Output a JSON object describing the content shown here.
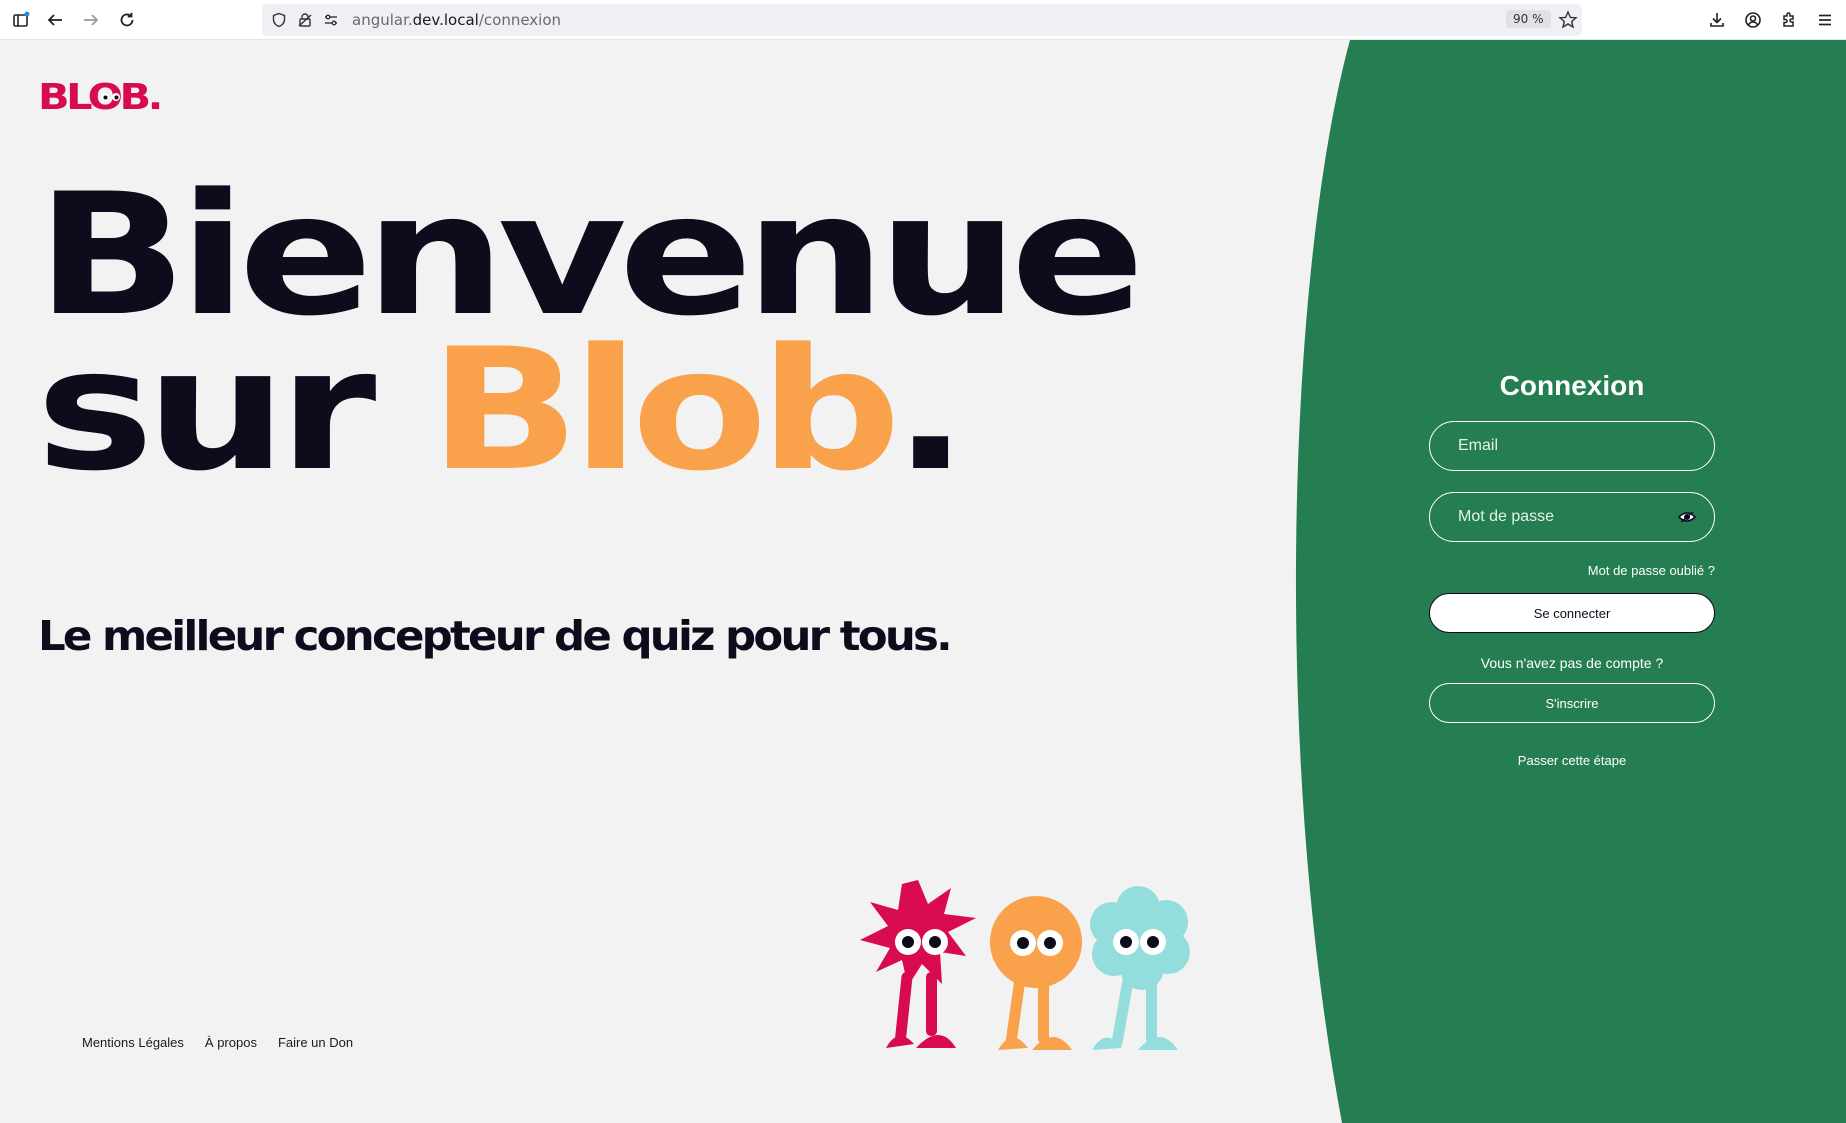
{
  "browser": {
    "url_prefix": "angular.",
    "url_host": "dev.local",
    "url_path": "/connexion",
    "zoom": "90 %"
  },
  "brand": {
    "logo_text": "BLOB.",
    "logo_color": "#d80b4f"
  },
  "hero": {
    "line1": "Bienvenue",
    "line2_prefix": "sur ",
    "line2_highlight": "Blob",
    "line2_dot": ".",
    "tagline": "Le meilleur concepteur de quiz pour tous."
  },
  "footer": {
    "links": [
      "Mentions Légales",
      "À propos",
      "Faire un Don"
    ]
  },
  "login": {
    "title": "Connexion",
    "email_placeholder": "Email",
    "password_placeholder": "Mot de passe",
    "forgot_password": "Mot de passe oublié ?",
    "submit_label": "Se connecter",
    "no_account": "Vous n'avez pas de compte ?",
    "register_label": "S'inscrire",
    "skip_label": "Passer cette étape"
  },
  "colors": {
    "green": "#257e52",
    "background": "#f2f2f2",
    "orange": "#f9a24b",
    "dark": "#0c0c1d",
    "pink": "#d80b4f",
    "cyan": "#93dedd"
  },
  "icons": [
    "sidebar-icon",
    "back-icon",
    "forward-icon",
    "reload-icon",
    "shield-icon",
    "lock-icon",
    "permissions-icon",
    "bookmark-star-icon",
    "download-icon",
    "account-icon",
    "extensions-icon",
    "menu-icon",
    "eye-icon"
  ]
}
